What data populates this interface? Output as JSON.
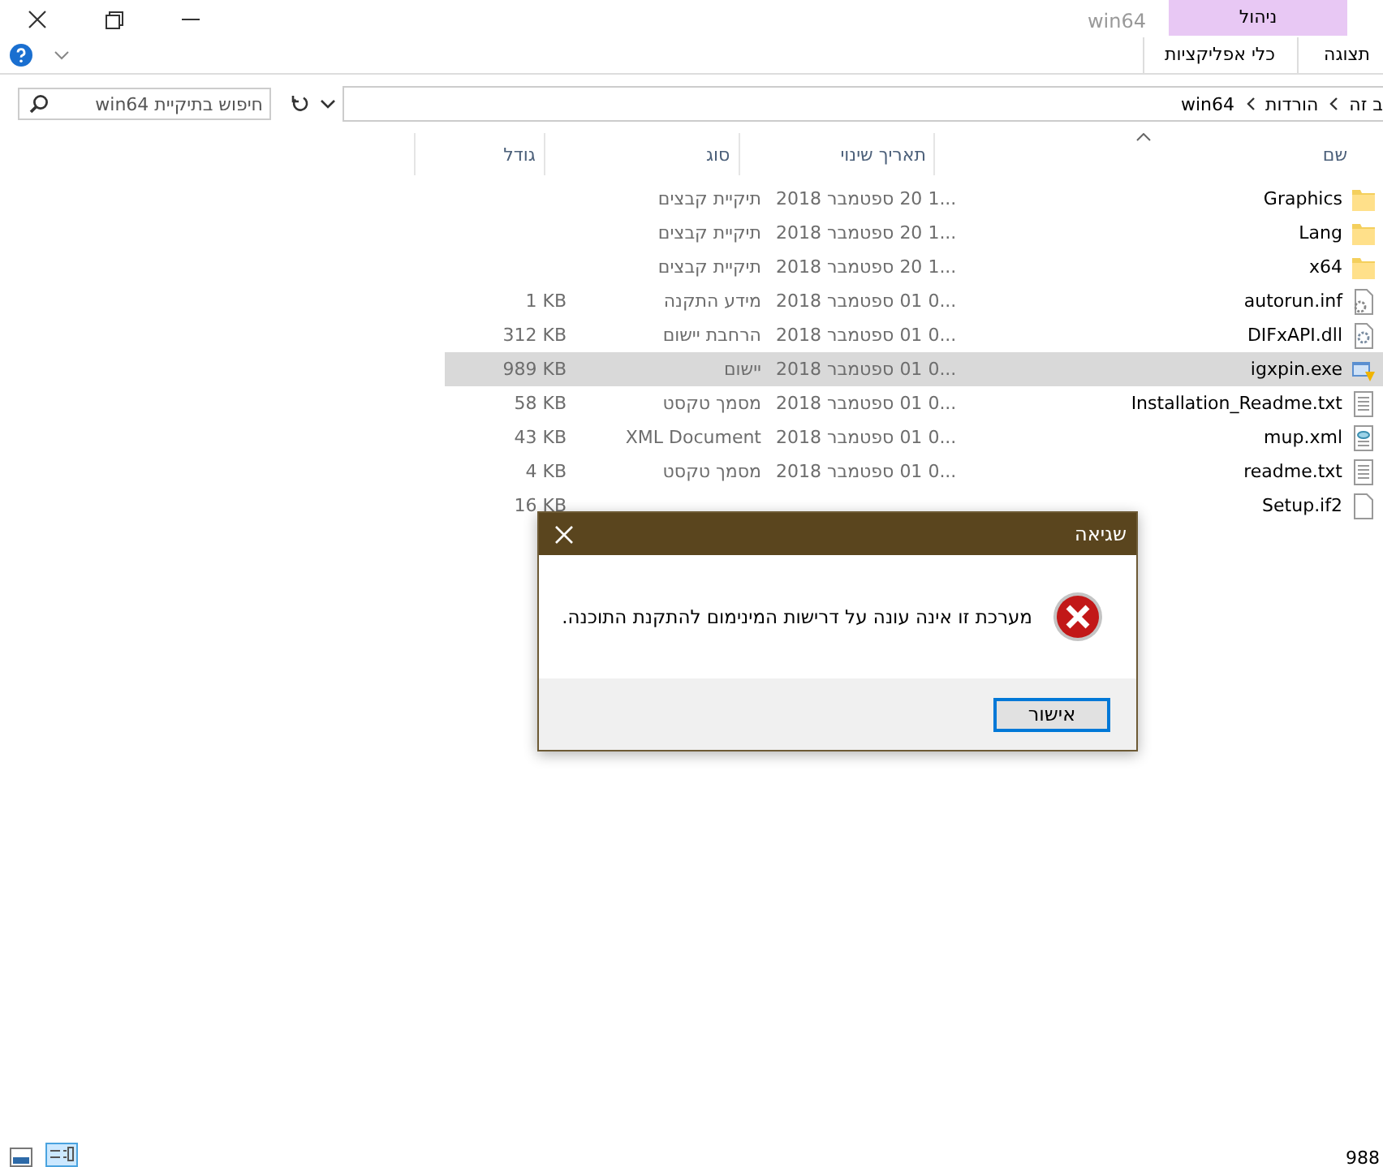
{
  "window": {
    "title": "win64"
  },
  "ribbon": {
    "context_group": "ניהול",
    "tabs": [
      {
        "label": "תצוגה",
        "selected": false
      },
      {
        "label": "כלי אפליקציות",
        "selected": false
      }
    ]
  },
  "address": {
    "crumbs": [
      "ב זה",
      "הורדות",
      "win64"
    ]
  },
  "search": {
    "placeholder": "חיפוש בתיקיית win64"
  },
  "columns": [
    "שם",
    "תאריך שינוי",
    "סוג",
    "גודל"
  ],
  "files": [
    {
      "name": "Graphics",
      "kind": "folder",
      "date": "...1 20 ספטמבר 2018",
      "type": "תיקיית קבצים",
      "selected": false
    },
    {
      "name": "Lang",
      "kind": "folder",
      "date": "...1 20 ספטמבר 2018",
      "type": "תיקיית קבצים",
      "selected": false
    },
    {
      "name": "x64",
      "kind": "folder",
      "date": "...1 20 ספטמבר 2018",
      "type": "תיקיית קבצים",
      "selected": false
    },
    {
      "name": "autorun.inf",
      "kind": "settings",
      "date": "...0 01 ספטמבר 2018",
      "type": "מידע התקנה",
      "size": "1 KB",
      "selected": false
    },
    {
      "name": "DIFxAPI.dll",
      "kind": "library",
      "date": "...0 01 ספטמבר 2018",
      "type": "הרחבת יישום",
      "size": "312 KB",
      "selected": false
    },
    {
      "name": "igxpin.exe",
      "kind": "app",
      "date": "...0 01 ספטמבר 2018",
      "type": "יישום",
      "size": "989 KB",
      "selected": true
    },
    {
      "name": "Installation_Readme.txt",
      "kind": "text",
      "date": "...0 01 ספטמבר 2018",
      "type": "מסמך טקסט",
      "size": "58 KB",
      "selected": false
    },
    {
      "name": "mup.xml",
      "kind": "xml",
      "date": "...0 01 ספטמבר 2018",
      "type": "XML Document",
      "size": "43 KB",
      "selected": false
    },
    {
      "name": "readme.txt",
      "kind": "text",
      "date": "...0 01 ספטמבר 2018",
      "type": "מסמך טקסט",
      "size": "4 KB",
      "selected": false
    },
    {
      "name": "Setup.if2",
      "kind": "blank",
      "size": "16 KB",
      "selected": false
    }
  ],
  "status_bar": {
    "count": "988"
  },
  "dialog": {
    "title": "שגיאה",
    "message": "מערכת זו אינה עונה על דרישות המינימום להתקנת התוכנה.",
    "button": "אישור"
  }
}
